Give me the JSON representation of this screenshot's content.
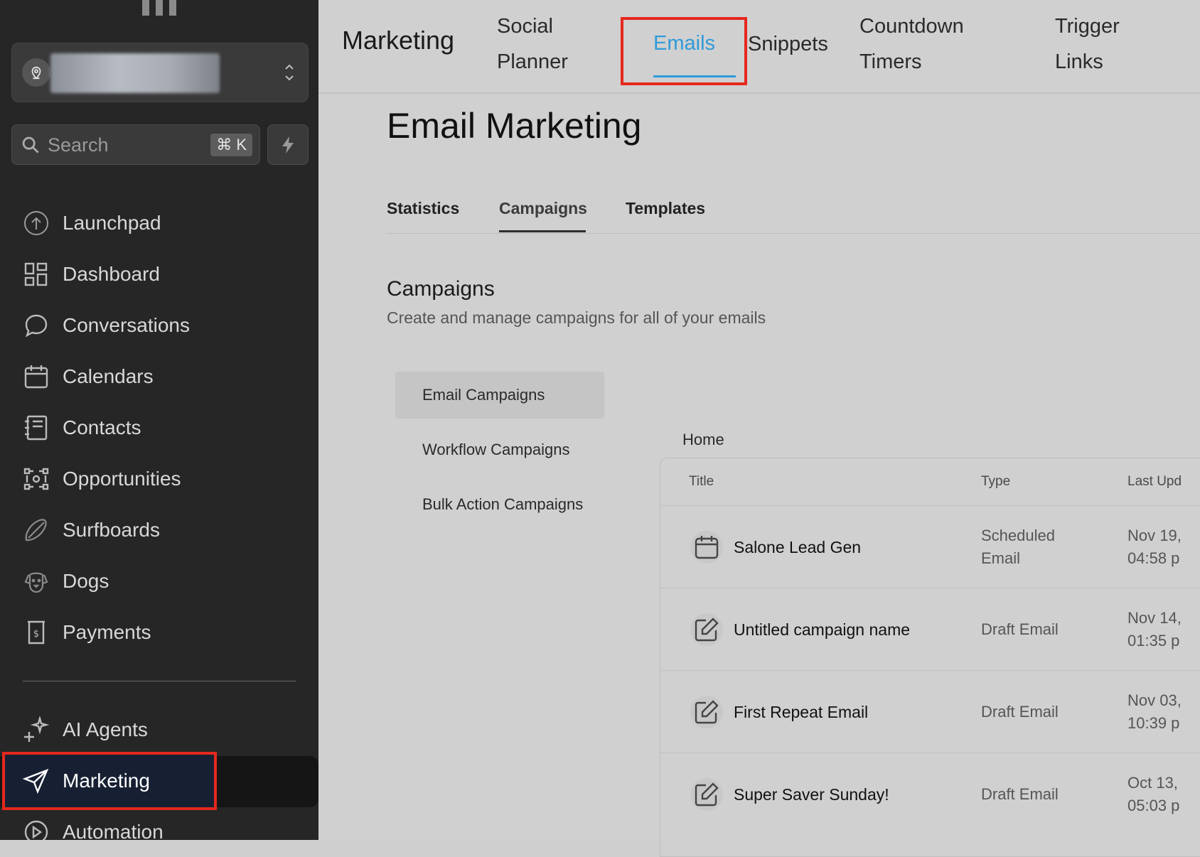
{
  "sidebar": {
    "search": {
      "placeholder": "Search",
      "shortcut": "⌘ K"
    },
    "items": [
      {
        "label": "Launchpad",
        "icon": "launchpad-icon"
      },
      {
        "label": "Dashboard",
        "icon": "dashboard-icon"
      },
      {
        "label": "Conversations",
        "icon": "chat-bubble-icon"
      },
      {
        "label": "Calendars",
        "icon": "calendar-icon"
      },
      {
        "label": "Contacts",
        "icon": "contacts-icon"
      },
      {
        "label": "Opportunities",
        "icon": "opportunities-icon"
      },
      {
        "label": "Surfboards",
        "icon": "surfboard-icon"
      },
      {
        "label": "Dogs",
        "icon": "dog-icon"
      },
      {
        "label": "Payments",
        "icon": "payments-icon"
      }
    ],
    "lower_items": [
      {
        "label": "AI Agents",
        "icon": "sparkles-icon"
      },
      {
        "label": "Marketing",
        "icon": "send-icon",
        "active": true
      },
      {
        "label": "Automation",
        "icon": "automation-icon"
      }
    ]
  },
  "topbar": {
    "title": "Marketing",
    "tabs": [
      {
        "line1": "Social",
        "line2": "Planner"
      },
      {
        "line1": "Emails",
        "line2": "",
        "active": true
      },
      {
        "line1": "Snippets",
        "line2": ""
      },
      {
        "line1": "Countdown",
        "line2": "Timers"
      },
      {
        "line1": "Trigger",
        "line2": "Links"
      }
    ]
  },
  "page": {
    "title": "Email Marketing",
    "subtabs": [
      "Statistics",
      "Campaigns",
      "Templates"
    ],
    "active_subtab": "Campaigns",
    "section_title": "Campaigns",
    "section_subtitle": "Create and manage campaigns for all of your emails",
    "left_menu": [
      "Email Campaigns",
      "Workflow Campaigns",
      "Bulk Action Campaigns"
    ],
    "breadcrumb": "Home"
  },
  "table": {
    "columns": [
      "Title",
      "Type",
      "Last Upd"
    ],
    "rows": [
      {
        "title": "Salone Lead Gen",
        "type": "Scheduled Email",
        "date": "Nov 19,\n04:58 p",
        "icon": "calendar-icon"
      },
      {
        "title": "Untitled campaign name",
        "type": "Draft Email",
        "date": "Nov 14,\n01:35 p",
        "icon": "edit-icon"
      },
      {
        "title": "First Repeat Email",
        "type": "Draft Email",
        "date": "Nov 03,\n10:39 p",
        "icon": "edit-icon"
      },
      {
        "title": "Super Saver Sunday!",
        "type": "Draft Email",
        "date": "Oct 13,\n05:03 p",
        "icon": "edit-icon"
      }
    ]
  },
  "colors": {
    "accent": "#2f9bd9",
    "highlight": "#e5281d",
    "sidebar_bg": "#262626"
  }
}
